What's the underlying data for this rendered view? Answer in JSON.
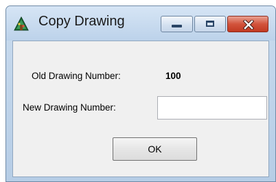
{
  "window": {
    "title": "Copy Drawing",
    "icon": "drawing-tree-icon",
    "controls": {
      "minimize_icon": "minimize-icon",
      "maximize_icon": "maximize-icon",
      "close_icon": "close-icon",
      "close_color": "#c13a22"
    }
  },
  "form": {
    "old_drawing_label": "Old Drawing Number:",
    "old_drawing_value": "100",
    "new_drawing_label": "New Drawing Number:",
    "new_drawing_value": "",
    "new_drawing_placeholder": ""
  },
  "buttons": {
    "ok_label": "OK"
  }
}
